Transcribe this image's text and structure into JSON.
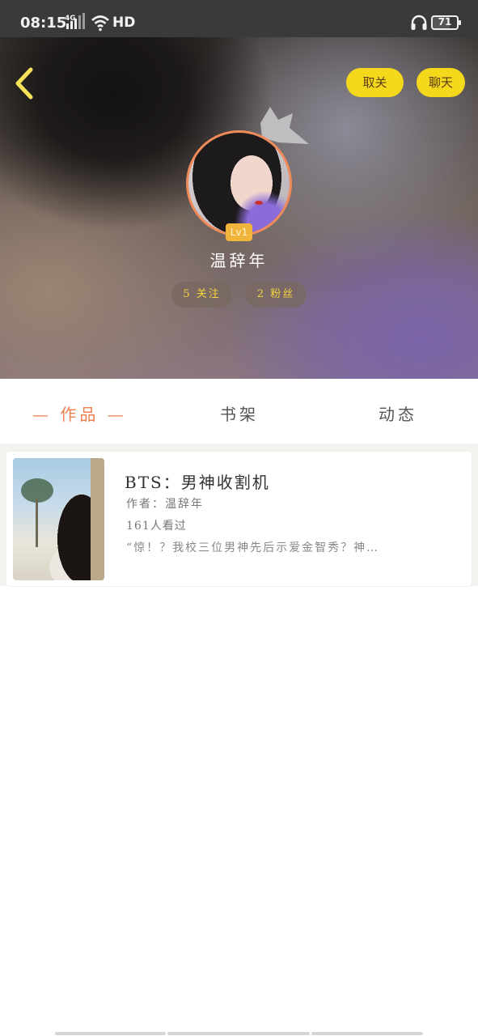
{
  "status_bar": {
    "time": "08:15",
    "network": "4G",
    "hd": "HD",
    "battery": "71",
    "battery_level": 0.71
  },
  "header": {
    "unfollow_label": "取关",
    "chat_label": "聊天",
    "level": "Lv1",
    "username": "温辞年",
    "following": "5 关注",
    "fans": "2 粉丝"
  },
  "tabs": [
    {
      "label": "— 作品 —",
      "active": true
    },
    {
      "label": "书架",
      "active": false
    },
    {
      "label": "动态",
      "active": false
    }
  ],
  "works": [
    {
      "title": "BTS：男神收割机",
      "author": "作者：温辞年",
      "views": "161人看过",
      "description": "“惊！？我校三位男神先后示爱金智秀？神…"
    }
  ],
  "colors": {
    "accent": "#ef7f4e",
    "button_yellow": "#f4d81c",
    "stat_text": "#f6d33a"
  }
}
